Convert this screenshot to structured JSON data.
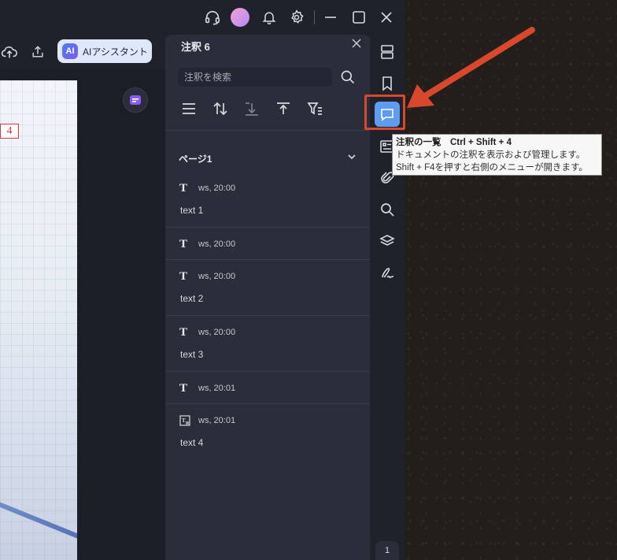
{
  "app": {
    "toolbar": {
      "ai_logo": "AI",
      "ai_label": "AIアシスタント"
    },
    "document": {
      "page_mark": "4"
    }
  },
  "panel": {
    "title": "注釈 6",
    "search_placeholder": "注釈を検索",
    "group_label": "ページ1",
    "items": [
      {
        "icon": "text-T-icon",
        "author_time": "ws,  20:00",
        "text": "text 1"
      },
      {
        "icon": "text-T-icon",
        "author_time": "ws,  20:00",
        "text": ""
      },
      {
        "icon": "text-T-icon",
        "author_time": "ws,  20:00",
        "text": "text 2"
      },
      {
        "icon": "text-T-icon",
        "author_time": "ws,  20:00",
        "text": "text 3"
      },
      {
        "icon": "text-T-icon",
        "author_time": "ws,  20:01",
        "text": ""
      },
      {
        "icon": "textbox-icon",
        "author_time": "ws,  20:01",
        "text": "text 4"
      }
    ]
  },
  "tooltip": {
    "title": "注釈の一覧　Ctrl + Shift + 4",
    "line1": "ドキュメントの注釈を表示および管理します。",
    "line2": "Shift + F4を押すと右側のメニューが開きます。"
  },
  "rail": {
    "page_number": "1"
  },
  "colors": {
    "accent": "#5e9cf0",
    "highlight": "#d9482c",
    "panel_bg": "#2a2d3a"
  }
}
